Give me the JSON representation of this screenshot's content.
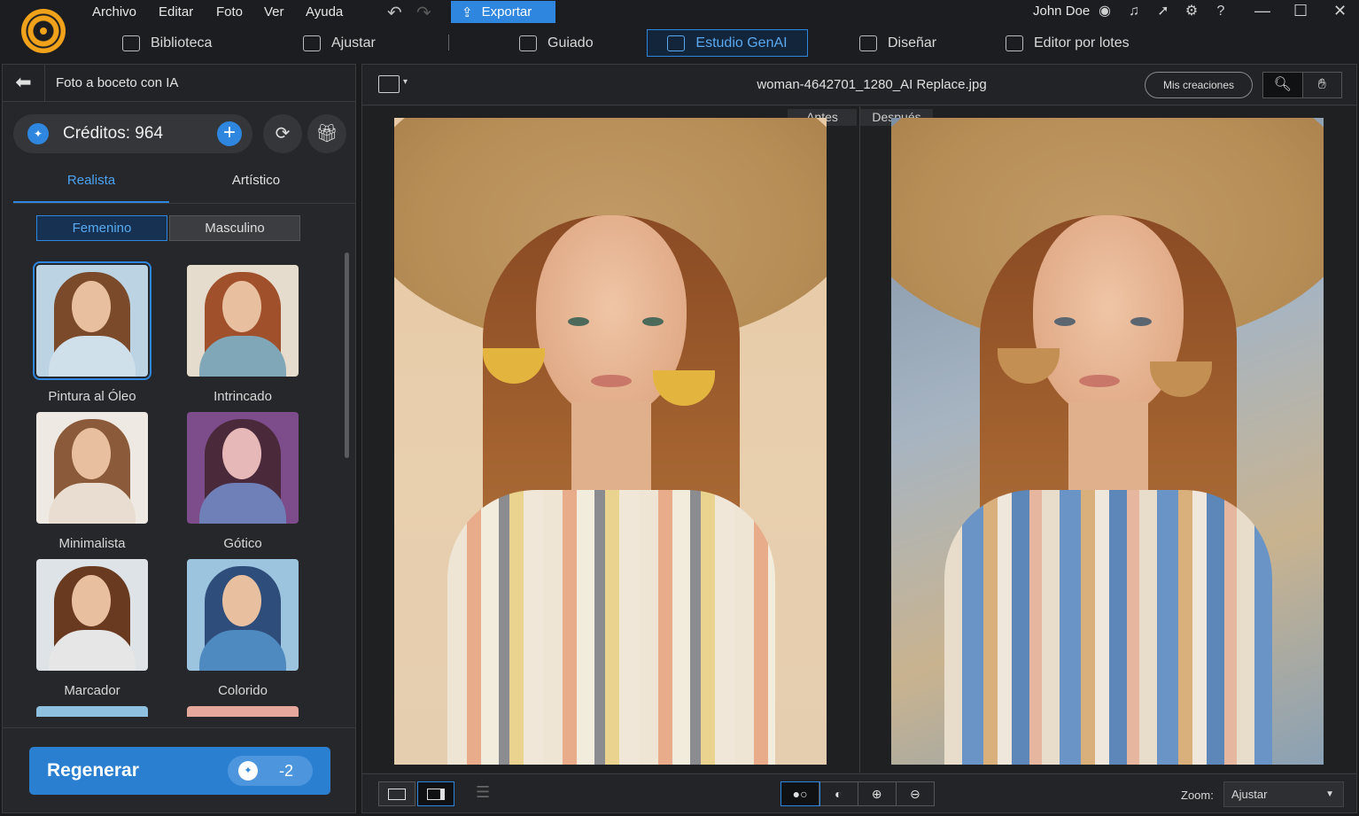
{
  "menu": [
    "Archivo",
    "Editar",
    "Foto",
    "Ver",
    "Ayuda"
  ],
  "toolbar": {
    "export_label": "Exportar",
    "undo_icon": "undo-icon",
    "redo_icon": "redo-icon"
  },
  "user": {
    "name": "John Doe"
  },
  "modes": [
    {
      "label": "Biblioteca",
      "icon": "image-icon"
    },
    {
      "label": "Ajustar",
      "icon": "sliders-icon"
    },
    {
      "label": "Guiado",
      "icon": "magic-wand-icon"
    },
    {
      "label": "Estudio GenAI",
      "icon": "sparkle-icon",
      "active": true
    },
    {
      "label": "Diseñar",
      "icon": "layers-icon"
    },
    {
      "label": "Editor por lotes",
      "icon": "images-icon"
    }
  ],
  "left_panel": {
    "title": "Foto a boceto con IA",
    "credits_label": "Créditos: 964",
    "tabs": [
      "Realista",
      "Artístico"
    ],
    "active_tab": "Realista",
    "gender": [
      "Femenino",
      "Masculino"
    ],
    "active_gender": "Femenino",
    "styles": [
      {
        "label": "Pintura al Óleo",
        "selected": true
      },
      {
        "label": "Intrincado"
      },
      {
        "label": "Minimalista"
      },
      {
        "label": "Gótico"
      },
      {
        "label": "Marcador"
      },
      {
        "label": "Colorido"
      }
    ],
    "regenerate_label": "Regenerar",
    "regenerate_cost": "-2"
  },
  "main": {
    "filename": "woman-4642701_1280_AI Replace.jpg",
    "my_creations": "Mis creaciones",
    "before_label": "Antes",
    "after_label": "Después",
    "zoom_label": "Zoom:",
    "zoom_value": "Ajustar"
  },
  "colors": {
    "accent": "#2e86de",
    "logo": "#f0a21a",
    "background": "#1a1b1d"
  }
}
